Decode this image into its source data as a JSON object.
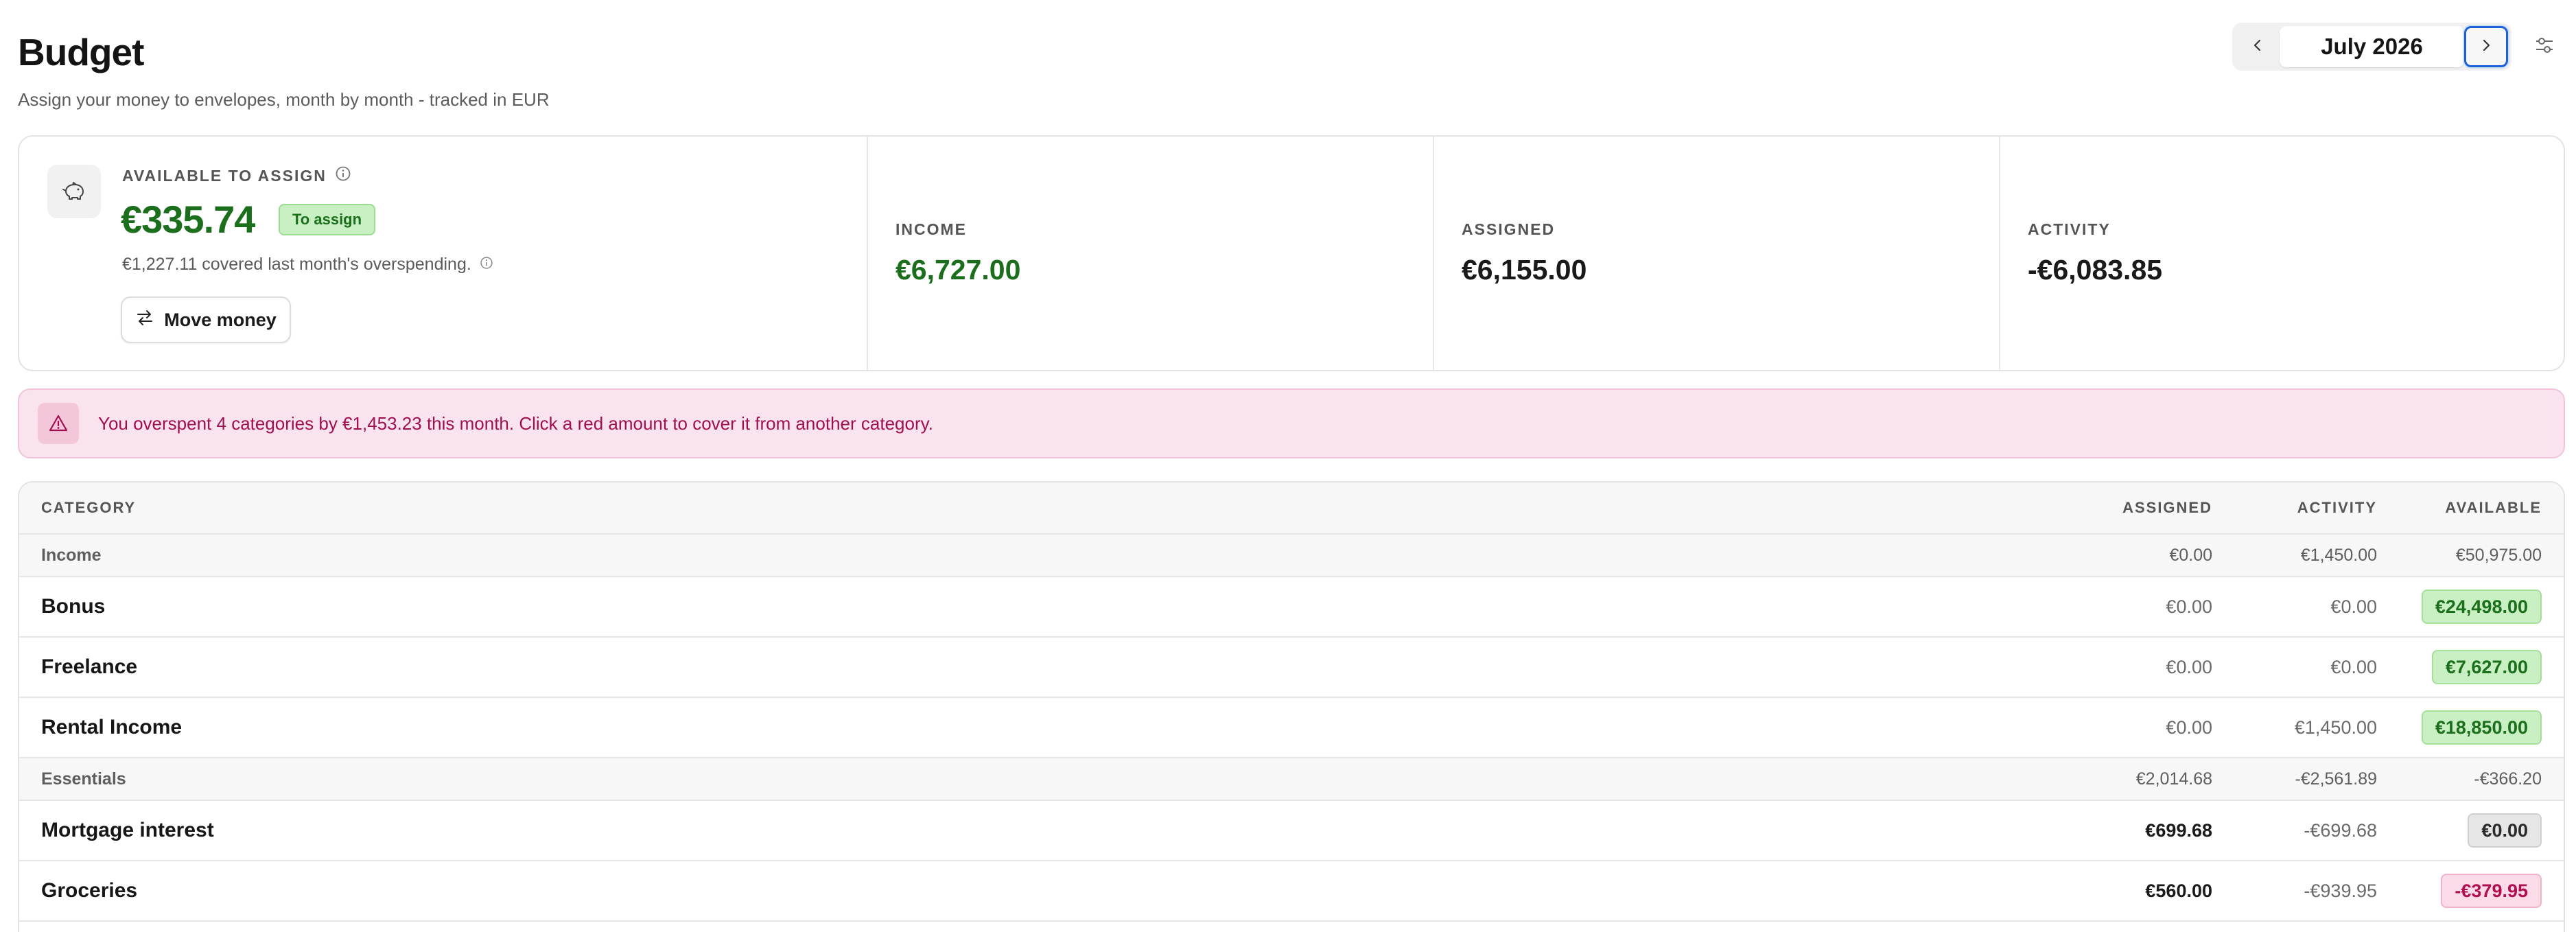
{
  "header": {
    "title": "Budget",
    "subtitle": "Assign your money to envelopes, month by month - tracked in EUR",
    "month": "July 2026",
    "icons": {
      "prev": "chevron-left-icon",
      "next": "chevron-right-icon",
      "settings": "sliders-icon"
    }
  },
  "summary": {
    "available": {
      "label": "AVAILABLE TO ASSIGN",
      "amount": "€335.74",
      "badge": "To assign",
      "note": "€1,227.11 covered last month's overspending.",
      "move_money": "Move money",
      "icon": "piggy-bank-icon"
    },
    "income": {
      "label": "INCOME",
      "value": "€6,727.00"
    },
    "assigned": {
      "label": "ASSIGNED",
      "value": "€6,155.00"
    },
    "activity": {
      "label": "ACTIVITY",
      "value": "-€6,083.85"
    }
  },
  "alert": {
    "text": "You overspent 4 categories by €1,453.23 this month. Click a red amount to cover it from another category.",
    "icon": "warning-triangle-icon"
  },
  "table": {
    "columns": {
      "category": "CATEGORY",
      "assigned": "ASSIGNED",
      "activity": "ACTIVITY",
      "available": "AVAILABLE"
    },
    "groups": [
      {
        "name": "Income",
        "assigned": "€0.00",
        "activity": "€1,450.00",
        "available": "€50,975.00",
        "rows": [
          {
            "name": "Bonus",
            "assigned": "€0.00",
            "activity": "€0.00",
            "available": "€24,498.00"
          },
          {
            "name": "Freelance",
            "assigned": "€0.00",
            "activity": "€0.00",
            "available": "€7,627.00"
          },
          {
            "name": "Rental Income",
            "assigned": "€0.00",
            "activity": "€1,450.00",
            "available": "€18,850.00"
          }
        ]
      },
      {
        "name": "Essentials",
        "assigned": "€2,014.68",
        "activity": "-€2,561.89",
        "available": "-€366.20",
        "rows": [
          {
            "name": "Mortgage interest",
            "assigned": "€699.68",
            "activity": "-€699.68",
            "available": "€0.00"
          },
          {
            "name": "Groceries",
            "assigned": "€560.00",
            "activity": "-€939.95",
            "available": "-€379.95"
          }
        ]
      }
    ]
  },
  "colors": {
    "positive": "#1b6e1b",
    "negative": "#b0104f",
    "accent": "#1f62d6",
    "alert_bg": "#f9e3ee"
  }
}
